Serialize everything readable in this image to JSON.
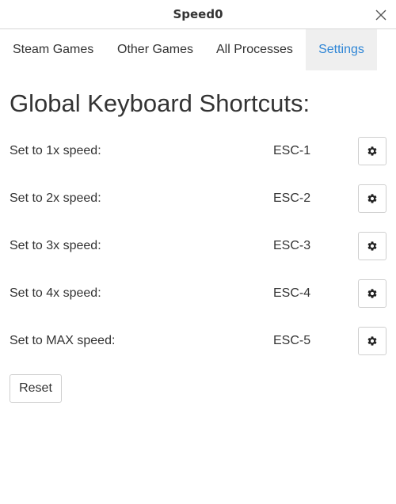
{
  "window": {
    "title": "Speed0"
  },
  "tabs": [
    {
      "label": "Steam Games"
    },
    {
      "label": "Other Games"
    },
    {
      "label": "All Processes"
    },
    {
      "label": "Settings"
    }
  ],
  "settings": {
    "heading": "Global Keyboard Shortcuts:",
    "shortcuts": [
      {
        "label": "Set to 1x speed:",
        "key": "ESC-1"
      },
      {
        "label": "Set to 2x speed:",
        "key": "ESC-2"
      },
      {
        "label": "Set to 3x speed:",
        "key": "ESC-3"
      },
      {
        "label": "Set to 4x speed:",
        "key": "ESC-4"
      },
      {
        "label": "Set to MAX speed:",
        "key": "ESC-5"
      }
    ],
    "reset_label": "Reset"
  },
  "icons": {
    "close": "close-icon",
    "gear": "gear-icon"
  },
  "colors": {
    "active_tab_text": "#2f86d6",
    "active_tab_bg": "#efefef"
  }
}
